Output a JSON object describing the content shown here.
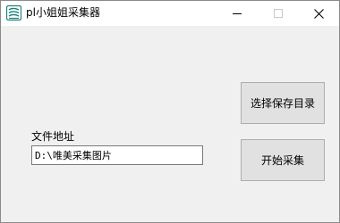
{
  "window": {
    "title": "pl小姐姐采集器",
    "app_icon": "app-logo-icon",
    "controls": {
      "minimize_icon": "minimize-icon",
      "maximize_icon": "maximize-icon",
      "close_icon": "close-icon"
    }
  },
  "form": {
    "address_label": "文件地址",
    "address_value": "D:\\唯美采集图片"
  },
  "buttons": {
    "choose_dir_label": "选择保存目录",
    "start_label": "开始采集"
  },
  "colors": {
    "background": "#f0f0f0",
    "titlebar": "#ffffff",
    "button_face": "#e1e1e1",
    "icon_teal": "#1a7f7a"
  }
}
